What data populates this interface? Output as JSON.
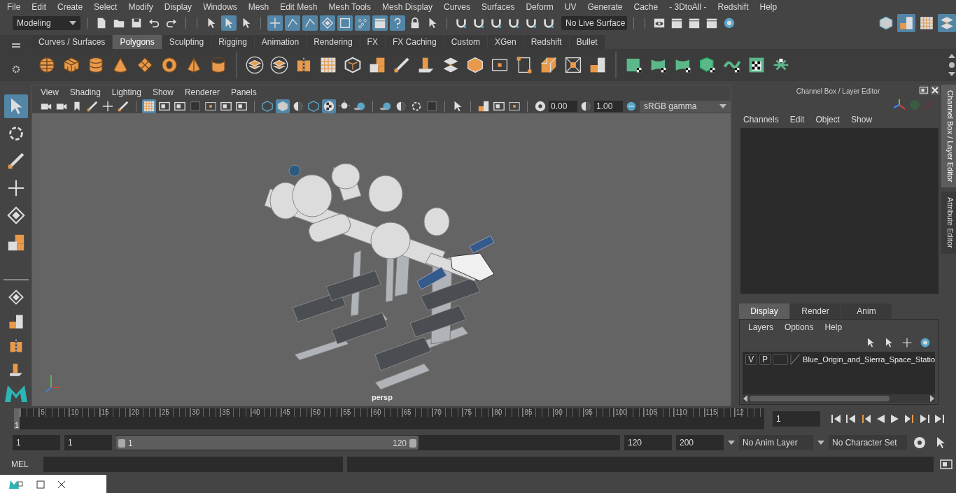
{
  "menu_bar": [
    "File",
    "Edit",
    "Create",
    "Select",
    "Modify",
    "Display",
    "Windows",
    "Mesh",
    "Edit Mesh",
    "Mesh Tools",
    "Mesh Display",
    "Curves",
    "Surfaces",
    "Deform",
    "UV",
    "Generate",
    "Cache",
    "- 3DtoAll -",
    "Redshift",
    "Help"
  ],
  "status_line": {
    "menu_set": "Modeling",
    "hierarchy_buttons": [
      {
        "selected": false
      },
      {
        "selected": true
      },
      {
        "selected": false
      }
    ],
    "mask_buttons": [
      {
        "selected": true
      },
      {
        "selected": true
      },
      {
        "selected": true
      },
      {
        "selected": true
      },
      {
        "selected": true
      },
      {
        "selected": true
      },
      {
        "selected": true
      },
      {
        "selected": true
      }
    ],
    "live_surface": "No Live Surface",
    "panel_buttons": [
      {
        "selected": false
      },
      {
        "selected": true
      },
      {
        "selected": false
      },
      {
        "selected": true
      }
    ]
  },
  "shelf": {
    "tabs": [
      {
        "label": "Curves / Surfaces",
        "selected": false
      },
      {
        "label": "Polygons",
        "selected": true
      },
      {
        "label": "Sculpting",
        "selected": false
      },
      {
        "label": "Rigging",
        "selected": false
      },
      {
        "label": "Animation",
        "selected": false
      },
      {
        "label": "Rendering",
        "selected": false
      },
      {
        "label": "FX",
        "selected": false
      },
      {
        "label": "FX Caching",
        "selected": false
      },
      {
        "label": "Custom",
        "selected": false
      },
      {
        "label": "XGen",
        "selected": false
      },
      {
        "label": "Redshift",
        "selected": false
      },
      {
        "label": "Bullet",
        "selected": false
      }
    ]
  },
  "toolbox": {
    "tools": [
      {
        "selected": true
      },
      {
        "selected": false
      },
      {
        "selected": false
      },
      {
        "selected": false
      },
      {
        "selected": false
      },
      {
        "selected": false
      }
    ]
  },
  "viewport": {
    "menus": [
      "View",
      "Shading",
      "Lighting",
      "Show",
      "Renderer",
      "Panels"
    ],
    "display_toggles": [
      {
        "selected": true
      },
      {
        "selected": false
      },
      {
        "selected": false
      },
      {
        "selected": false
      },
      {
        "selected": false
      },
      {
        "selected": false
      },
      {
        "selected": false
      }
    ],
    "shading_toggles": [
      {
        "selected": false
      },
      {
        "selected": true
      },
      {
        "selected": false
      },
      {
        "selected": false
      },
      {
        "selected": true
      },
      {
        "selected": false
      },
      {
        "selected": false
      }
    ],
    "exposure": "0.00",
    "gamma": "1.00",
    "color_space": "sRGB gamma",
    "camera": "persp"
  },
  "channel_box": {
    "title": "Channel Box / Layer Editor",
    "menus": [
      "Channels",
      "Edit",
      "Object",
      "Show"
    ],
    "layer_tabs": [
      {
        "label": "Display",
        "selected": true
      },
      {
        "label": "Render",
        "selected": false
      },
      {
        "label": "Anim",
        "selected": false
      }
    ],
    "layer_menus": [
      "Layers",
      "Options",
      "Help"
    ],
    "layers": [
      {
        "visible": "V",
        "playback": "P",
        "name": "Blue_Origin_and_Sierra_Space_Statio"
      }
    ]
  },
  "side_tabs": [
    {
      "label": "Channel Box / Layer Editor",
      "selected": true
    },
    {
      "label": "Attribute Editor",
      "selected": false
    }
  ],
  "time_slider": {
    "current_marker": "1",
    "level": 0,
    "ticks": [
      "5",
      "10",
      "15",
      "20",
      "25",
      "30",
      "35",
      "40",
      "45",
      "50",
      "55",
      "60",
      "65",
      "70",
      "75",
      "80",
      "85",
      "90",
      "95",
      "100",
      "105",
      "110",
      "115",
      "12"
    ],
    "current_frame": "1"
  },
  "range_slider": {
    "start_time": "1",
    "playback_start": "1",
    "range_start": "1",
    "range_end": "120",
    "level": 0.6,
    "playback_end": "120",
    "end_time": "200",
    "anim_layer": "No Anim Layer",
    "character_set": "No Character Set"
  },
  "command_line": {
    "language": "MEL"
  }
}
